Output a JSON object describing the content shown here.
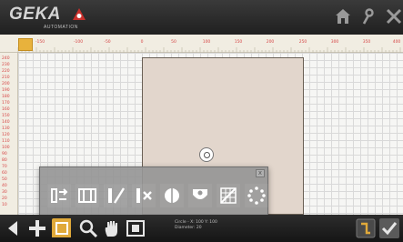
{
  "header": {
    "logo_text": "GEKA",
    "logo_subtext": "AUTOMATION",
    "icons": [
      "home-icon",
      "settings-icon",
      "close-icon"
    ]
  },
  "ruler": {
    "h_ticks": [
      "-150",
      "-100",
      "-50",
      "0",
      "50",
      "100",
      "150",
      "200",
      "250",
      "300",
      "350",
      "400"
    ],
    "v_ticks": [
      "240",
      "230",
      "220",
      "210",
      "200",
      "190",
      "180",
      "170",
      "160",
      "150",
      "140",
      "130",
      "120",
      "110",
      "100",
      "90",
      "80",
      "70",
      "60",
      "50",
      "40",
      "30",
      "20",
      "10"
    ]
  },
  "palette": {
    "close_label": "x",
    "tools": [
      "cut-sides-tool-icon",
      "slot-tool-icon",
      "angle-cut-tool-icon",
      "cancel-cut-tool-icon",
      "round-hole-tool-icon",
      "shield-shape-tool-icon",
      "mesh-grid-tool-icon",
      "circle-pattern-tool-icon"
    ]
  },
  "status": {
    "line1": "Circle - X: 100  Y: 100",
    "line2": "Diameter: 20"
  },
  "colors": {
    "accent": "#e0a93a",
    "workpiece": "#e2d6cc",
    "ruler_text": "#d64545"
  }
}
